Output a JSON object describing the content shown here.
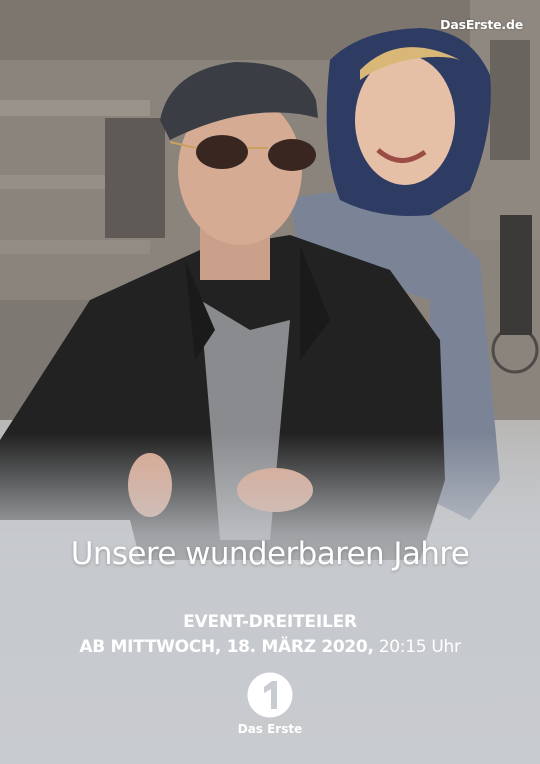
{
  "poster": {
    "watermark": "DasErste.de",
    "title": "Unsere wunderbaren Jahre",
    "subtitle": "EVENT-DREITEILER",
    "date_bold": "AB MITTWOCH, 18. MÄRZ 2020,",
    "time": "20:15 Uhr",
    "logo_label": "Das Erste",
    "logo_icon": "das-erste-logo-icon",
    "colors": {
      "text": "#ffffff",
      "background_bottom": "#c8cbcf"
    }
  }
}
